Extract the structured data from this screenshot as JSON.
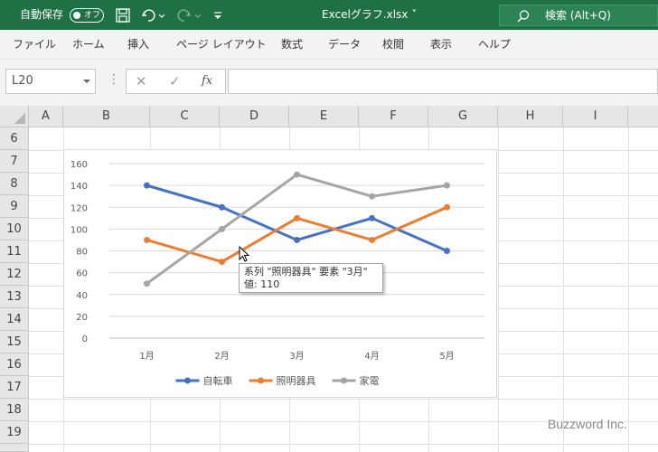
{
  "titlebar": {
    "autosave_label": "自動保存",
    "autosave_state": "オフ",
    "filename": "Excelグラフ.xlsx ˅",
    "search_text": "検索 (Alt+Q)",
    "accent": "#1f7145"
  },
  "ribbon": {
    "tabs": [
      "ファイル",
      "ホーム",
      "挿入",
      "ページ レイアウト",
      "数式",
      "データ",
      "校閲",
      "表示",
      "ヘルプ"
    ]
  },
  "formulabar": {
    "namebox_value": "L20",
    "cancel_glyph": "✕",
    "enter_glyph": "✓",
    "fx_glyph": "fx",
    "formula_value": ""
  },
  "grid": {
    "columns": [
      "A",
      "B",
      "C",
      "D",
      "E",
      "F",
      "G",
      "H",
      "I"
    ],
    "rows": [
      "6",
      "7",
      "8",
      "9",
      "10",
      "11",
      "12",
      "13",
      "14",
      "15",
      "16",
      "17",
      "18",
      "19",
      "20"
    ]
  },
  "chart_data": {
    "type": "line",
    "categories": [
      "1月",
      "2月",
      "3月",
      "4月",
      "5月"
    ],
    "ylim": [
      0,
      160
    ],
    "yticks": [
      "0",
      "20",
      "40",
      "60",
      "80",
      "100",
      "120",
      "140",
      "160"
    ],
    "grid": true,
    "legend": "bottom",
    "series": [
      {
        "name": "自転車",
        "values": [
          140,
          120,
          90,
          110,
          80
        ],
        "color": "#4472c4"
      },
      {
        "name": "照明器具",
        "values": [
          90,
          70,
          110,
          90,
          120
        ],
        "color": "#ed7d31"
      },
      {
        "name": "家電",
        "values": [
          50,
          100,
          150,
          130,
          140
        ],
        "color": "#a5a5a5"
      }
    ]
  },
  "tooltip": {
    "line1": "系列 \"照明器具\" 要素 \"3月\"",
    "line2": "値: 110"
  },
  "watermark": "Buzzword Inc."
}
